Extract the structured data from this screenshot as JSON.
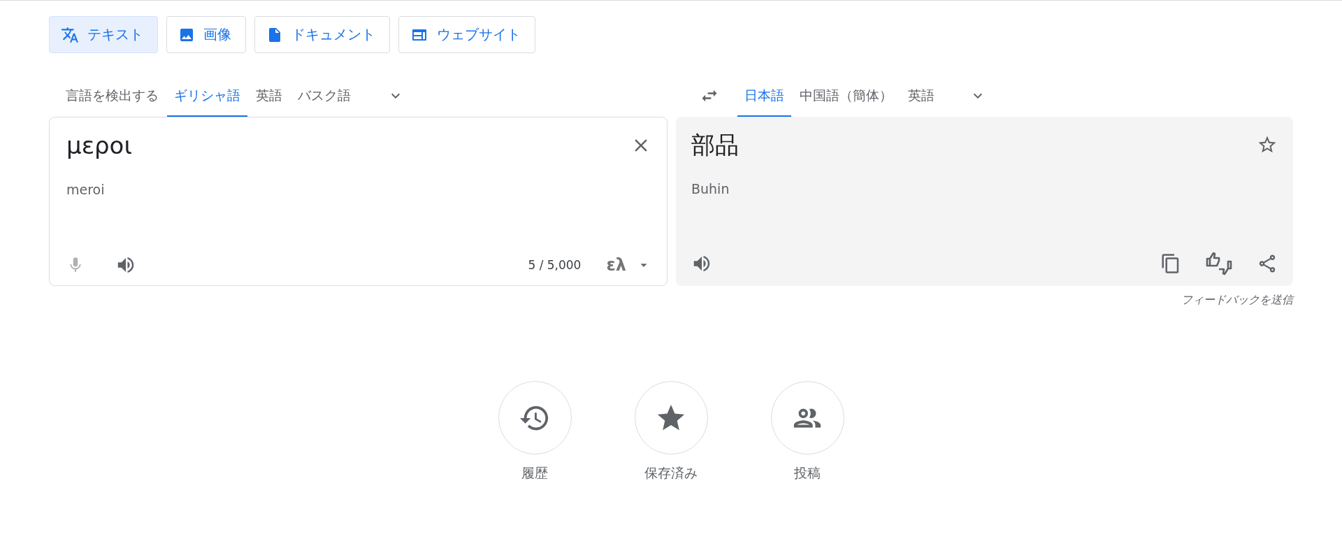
{
  "modes": [
    {
      "kind": "text",
      "label": "テキスト",
      "selected": true
    },
    {
      "kind": "image",
      "label": "画像",
      "selected": false
    },
    {
      "kind": "document",
      "label": "ドキュメント",
      "selected": false
    },
    {
      "kind": "website",
      "label": "ウェブサイト",
      "selected": false
    }
  ],
  "source_languages": [
    {
      "label": "言語を検出する",
      "selected": false
    },
    {
      "label": "ギリシャ語",
      "selected": true
    },
    {
      "label": "英語",
      "selected": false
    },
    {
      "label": "バスク語",
      "selected": false
    }
  ],
  "target_languages": [
    {
      "label": "日本語",
      "selected": true
    },
    {
      "label": "中国語（簡体）",
      "selected": false
    },
    {
      "label": "英語",
      "selected": false
    }
  ],
  "source": {
    "text": "μεροι",
    "transliteration": "meroi",
    "char_count": "5 / 5,000",
    "input_tool": "ελ"
  },
  "target": {
    "text": "部品",
    "transliteration": "Buhin"
  },
  "feedback": "フィードバックを送信",
  "shortcuts": [
    {
      "kind": "history",
      "label": "履歴"
    },
    {
      "kind": "saved",
      "label": "保存済み"
    },
    {
      "kind": "contribute",
      "label": "投稿"
    }
  ]
}
